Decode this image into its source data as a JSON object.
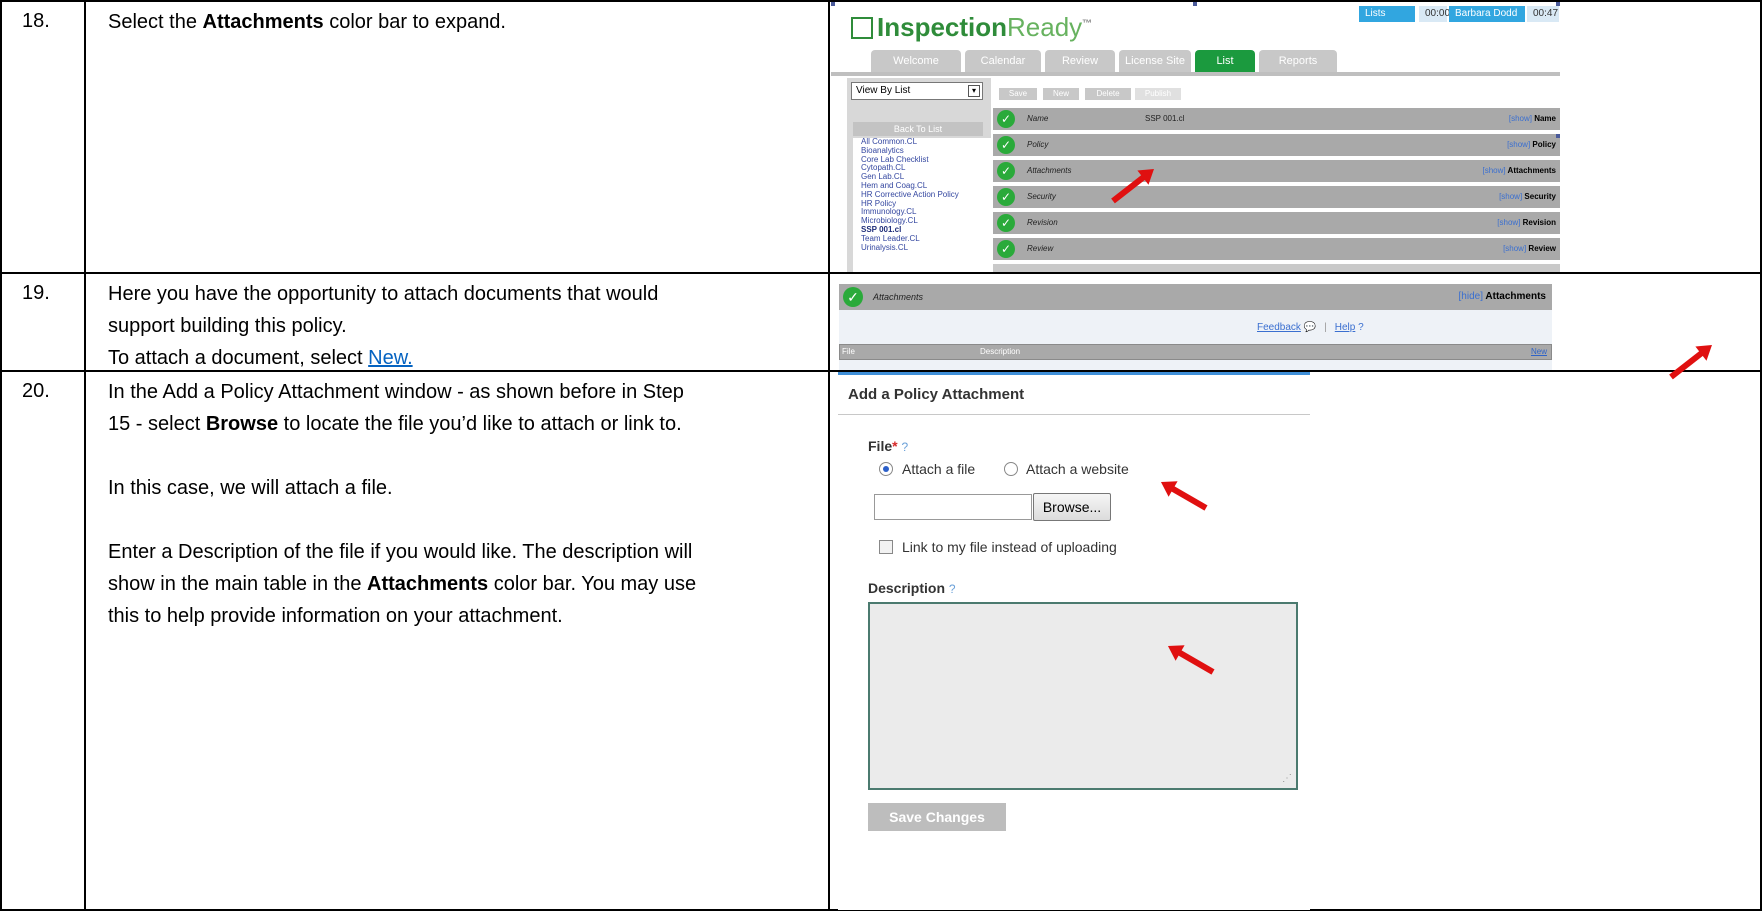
{
  "steps": [
    {
      "number": "18.",
      "text_parts": [
        "Select the ",
        "Attachments",
        " color bar to expand."
      ]
    },
    {
      "number": "19.",
      "line1": "Here you have the opportunity to attach documents that would",
      "line2": "support building this policy.",
      "line3_prefix": "To attach a document, select ",
      "line3_link": "New."
    },
    {
      "number": "20.",
      "p1_line1": "In the Add a Policy Attachment window - as shown before in Step",
      "p1_line2_a": "15 - select ",
      "p1_line2_b": "Browse",
      "p1_line2_c": " to locate the file you’d like to attach or link to.",
      "p2": "In this case, we will attach a file.",
      "p3_line1": "Enter a Description of the file if you would like.  The description will",
      "p3_line2_a": "show in the main table in the ",
      "p3_line2_b": "Attachments",
      "p3_line2_c": " color bar.  You may use",
      "p3_line3": "this to help provide information on your attachment."
    }
  ],
  "shot1": {
    "logo_bold": "Inspection",
    "logo_light": "Ready",
    "logo_tm": "™",
    "top_items": [
      "Lists",
      "00:00",
      "Barbara Dodd",
      "00:47"
    ],
    "tabs": [
      "Welcome",
      "Calendar",
      "Review",
      "License Site",
      "List",
      "Reports"
    ],
    "active_tab": "List",
    "view_select": "View By List",
    "back_to_list": "Back To List",
    "tree_items": [
      "All Common.CL",
      "Bioanalytics",
      "Core Lab Checklist",
      "Cytopath.CL",
      "Gen Lab.CL",
      "Hem and Coag.CL",
      "HR Corrective Action Policy",
      "HR Policy",
      "Immunology.CL",
      "Microbiology.CL",
      "SSP 001.cl",
      "Team Leader.CL",
      "Urinalysis.CL"
    ],
    "selected_tree_item": "SSP 001.cl",
    "actions": [
      "Save",
      "New",
      "Delete",
      "Publish"
    ],
    "bars": [
      {
        "label": "Name",
        "value": "SSP 001.cl",
        "show": "[show]",
        "right": "Name"
      },
      {
        "label": "Policy",
        "value": "",
        "show": "[show]",
        "right": "Policy"
      },
      {
        "label": "Attachments",
        "value": "",
        "show": "[show]",
        "right": "Attachments"
      },
      {
        "label": "Security",
        "value": "",
        "show": "[show]",
        "right": "Security"
      },
      {
        "label": "Revision",
        "value": "",
        "show": "[show]",
        "right": "Revision"
      },
      {
        "label": "Review",
        "value": "",
        "show": "[show]",
        "right": "Review"
      }
    ]
  },
  "shot2": {
    "bar_label": "Attachments",
    "hide": "[hide]",
    "bar_right": "Attachments",
    "feedback": "Feedback",
    "help": "Help",
    "col_file": "File",
    "col_description": "Description",
    "new_link": "New"
  },
  "shot3": {
    "title": "Add a Policy Attachment",
    "file_label": "File",
    "required_mark": "*",
    "question_mark": "?",
    "radio_attach_file": "Attach a file",
    "radio_attach_website": "Attach a website",
    "browse_button": "Browse...",
    "link_checkbox": "Link to my file instead of uploading",
    "description_label": "Description",
    "save_button": "Save Changes"
  },
  "colors": {
    "green": "#2aaa3a",
    "blue_link": "#0563c1",
    "arrow": "#e01010",
    "bar_gray": "#a9a9a9"
  }
}
